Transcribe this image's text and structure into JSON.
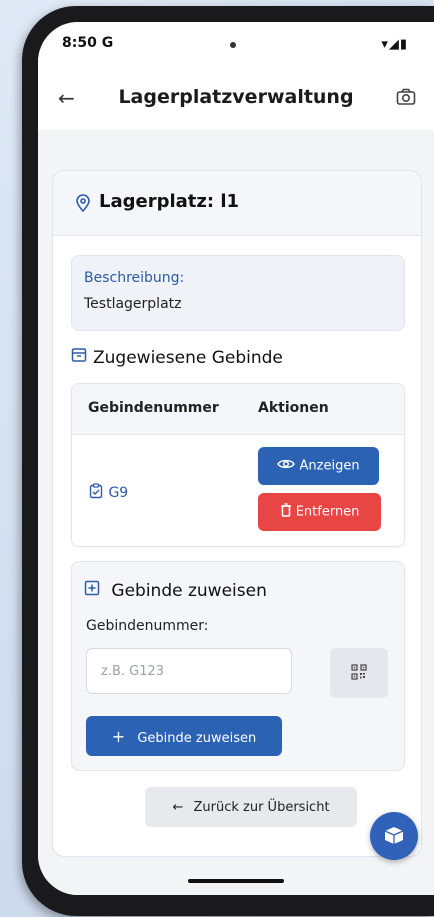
{
  "status_bar": {
    "time": "8:50",
    "carrier_badge": "G",
    "icons": "▾◢▮"
  },
  "app_bar": {
    "title": "Lagerplatzverwaltung"
  },
  "card": {
    "title": "Lagerplatz: l1",
    "description_label": "Beschreibung:",
    "description_value": "Testlagerplatz"
  },
  "assigned": {
    "title": "Zugewiesene Gebinde",
    "columns": [
      "Gebindenummer",
      "Aktionen"
    ],
    "rows": [
      {
        "gebinde": "G9",
        "show_label": "Anzeigen",
        "remove_label": "Entfernen"
      }
    ]
  },
  "assign": {
    "title": "Gebinde zuweisen",
    "field_label": "Gebindenummer:",
    "placeholder": "z.B. G123",
    "value": "",
    "button_label": "Gebinde zuweisen"
  },
  "footer": {
    "back_label": "Zurück zur Übersicht"
  },
  "colors": {
    "primary": "#2b62b4",
    "danger": "#e84545",
    "link": "#2e5aa6"
  }
}
